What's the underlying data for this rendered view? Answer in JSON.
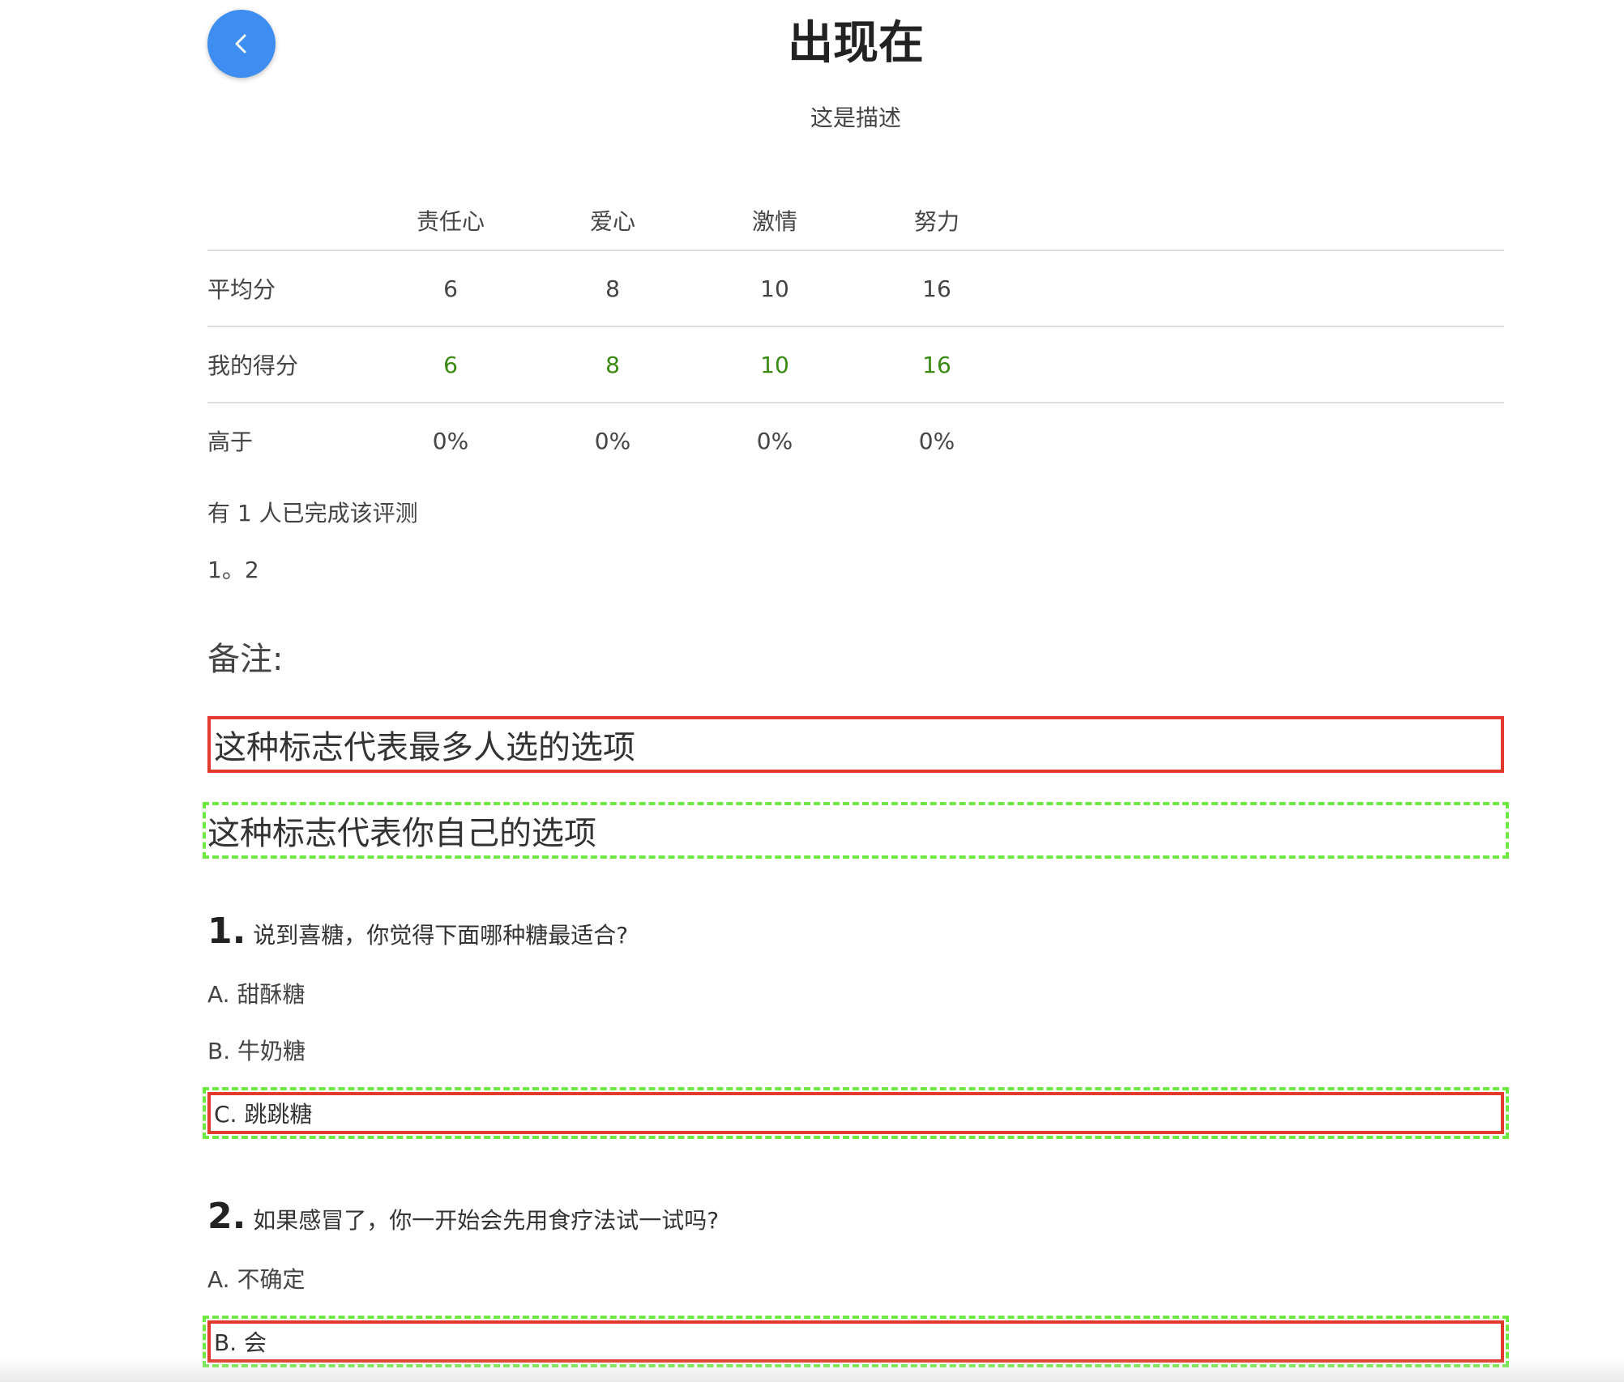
{
  "header": {
    "title": "出现在",
    "description": "这是描述",
    "back_icon": "chevron-left-icon",
    "accent_color": "#3d8ef0"
  },
  "score_table": {
    "columns": [
      "责任心",
      "爱心",
      "激情",
      "努力"
    ],
    "rows": [
      {
        "label": "平均分",
        "values": [
          "6",
          "8",
          "10",
          "16"
        ]
      },
      {
        "label": "我的得分",
        "values": [
          "6",
          "8",
          "10",
          "16"
        ],
        "color": "#3a8a12"
      },
      {
        "label": "高于",
        "values": [
          "0%",
          "0%",
          "0%",
          "0%"
        ]
      }
    ]
  },
  "completion_text": "有 1 人已完成该评测",
  "extra_text": "1。2",
  "notes": {
    "heading": "备注:",
    "legend_most_chosen": "这种标志代表最多人选的选项",
    "legend_own_choice": "这种标志代表你自己的选项",
    "most_chosen_color": "#e23b2e",
    "own_choice_color": "#6ee843"
  },
  "questions": [
    {
      "number": "1.",
      "text": "说到喜糖，你觉得下面哪种糖最适合?",
      "options": [
        "A. 甜酥糖",
        "B. 牛奶糖",
        "C. 跳跳糖"
      ]
    },
    {
      "number": "2.",
      "text": "如果感冒了，你一开始会先用食疗法试一试吗?",
      "options": [
        "A. 不确定",
        "B. 会"
      ]
    }
  ]
}
